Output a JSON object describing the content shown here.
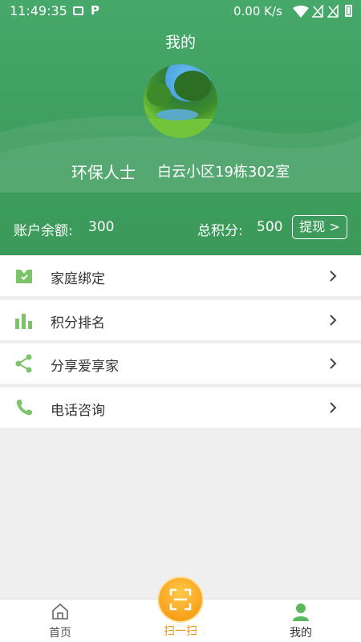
{
  "status_bar": {
    "time": "11:49:35",
    "network_speed": "0.00 K/s",
    "icons": [
      "image-icon",
      "p-icon",
      "wifi-icon",
      "sim-1-no-signal-icon",
      "sim-2-no-signal-icon",
      "battery-icon"
    ]
  },
  "header": {
    "title": "我的",
    "user_name": "环保人士",
    "address": "白云小区19栋302室",
    "balance_label": "账户余额:",
    "balance_value": "300",
    "points_label": "总积分:",
    "points_value": "500",
    "withdraw_label": "提现 >"
  },
  "menu": {
    "items": [
      {
        "label": "家庭绑定",
        "icon": "family-binding-icon"
      },
      {
        "label": "积分排名",
        "icon": "bar-chart-icon"
      },
      {
        "label": "分享爱享家",
        "icon": "share-icon"
      },
      {
        "label": "电话咨询",
        "icon": "phone-icon"
      }
    ]
  },
  "bottom_nav": {
    "home_label": "首页",
    "scan_label": "扫一扫",
    "mine_label": "我的",
    "active": "mine"
  },
  "colors": {
    "header_green": "#43a464",
    "menu_icon_green": "#7cc46a",
    "active_nav_green": "#5cb85c",
    "scan_orange": "#f7a21b",
    "background": "#efefef"
  }
}
